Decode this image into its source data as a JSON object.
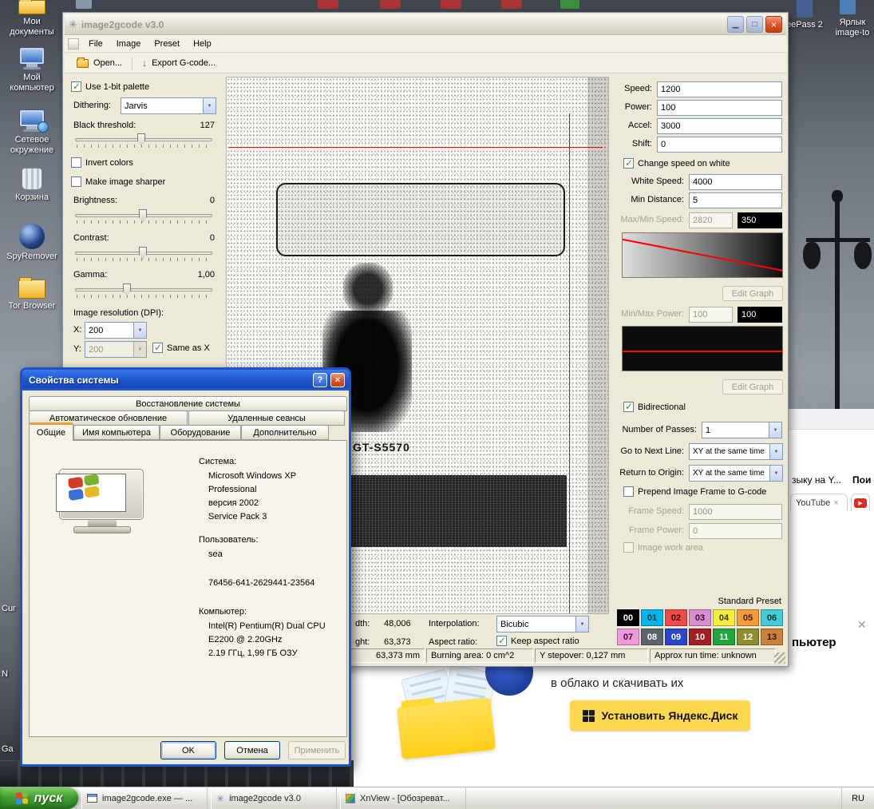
{
  "colors": {
    "guide_red": "#ff0000",
    "luna_blue": "#2058d0",
    "close_red": "#d9531f",
    "start_green": "#3fa030",
    "yandex_yellow": "#ffd84d",
    "check_green": "#21a121"
  },
  "desktop": {
    "icons": [
      {
        "label": "Мои документы"
      },
      {
        "label": "Мой компьютер"
      },
      {
        "label": "Сетевое окружение"
      },
      {
        "label": "Корзина"
      },
      {
        "label": "SpyRemover"
      },
      {
        "label": "Tor Browser"
      }
    ],
    "right_labels": [
      {
        "label": "eePass 2"
      },
      {
        "label": "Ярлык image-to"
      }
    ],
    "edge_labels": [
      {
        "label": "Cur"
      },
      {
        "label": "N"
      },
      {
        "label": "Ga"
      }
    ]
  },
  "window": {
    "title": "image2gcode v3.0",
    "menu": [
      {
        "label": "File"
      },
      {
        "label": "Image"
      },
      {
        "label": "Preset"
      },
      {
        "label": "Help"
      }
    ],
    "toolbar": {
      "open": "Open...",
      "export": "Export G-code..."
    },
    "left": {
      "use_1bit": "Use 1-bit palette",
      "dithering_label": "Dithering:",
      "dithering_value": "Jarvis",
      "black_threshold_label": "Black threshold:",
      "black_threshold_value": "127",
      "invert_colors": "Invert colors",
      "make_sharper": "Make image sharper",
      "brightness_label": "Brightness:",
      "brightness_value": "0",
      "contrast_label": "Contrast:",
      "contrast_value": "0",
      "gamma_label": "Gamma:",
      "gamma_value": "1,00",
      "resolution_label": "Image resolution (DPI):",
      "x_label": "X:",
      "x_value": "200",
      "y_label": "Y:",
      "y_value": "200",
      "same_as_x": "Same as X"
    },
    "right": {
      "speed_label": "Speed:",
      "speed": "1200",
      "power_label": "Power:",
      "power": "100",
      "accel_label": "Accel:",
      "accel": "3000",
      "shift_label": "Shift:",
      "shift": "0",
      "change_speed_on_white": "Change speed on white",
      "white_speed_label": "White Speed:",
      "white_speed": "4000",
      "min_distance_label": "Min Distance:",
      "min_distance": "5",
      "maxmin_speed_label": "Max/Min Speed:",
      "max_speed": "2820",
      "min_speed": "350",
      "edit_graph": "Edit Graph",
      "minmax_power_label": "Min/Max Power:",
      "min_power": "100",
      "max_power": "100",
      "bidirectional": "Bidirectional",
      "passes_label": "Number of Passes:",
      "passes": "1",
      "next_line_label": "Go to Next Line:",
      "next_line": "XY at the same time",
      "return_origin_label": "Return to Origin:",
      "return_origin": "XY at the same time",
      "prepend_frame": "Prepend Image Frame to G-code",
      "frame_speed_label": "Frame Speed:",
      "frame_speed": "1000",
      "frame_power_label": "Frame Power:",
      "frame_power": "0",
      "image_work_area": "Image work area",
      "standard_preset": "Standard Preset",
      "swatches": [
        {
          "label": "00",
          "bg": "#000000",
          "fg": "#ffffff"
        },
        {
          "label": "01",
          "bg": "#00b6ea",
          "fg": "#00323f"
        },
        {
          "label": "02",
          "bg": "#f04a49",
          "fg": "#3c0202"
        },
        {
          "label": "03",
          "bg": "#d98ed0",
          "fg": "#3a1236"
        },
        {
          "label": "04",
          "bg": "#f6ec3e",
          "fg": "#3c3a02"
        },
        {
          "label": "05",
          "bg": "#f59a38",
          "fg": "#3d2102"
        },
        {
          "label": "06",
          "bg": "#43cbd8",
          "fg": "#063337"
        },
        {
          "label": "07",
          "bg": "#f09add",
          "fg": "#3c1033"
        },
        {
          "label": "08",
          "bg": "#5a646e",
          "fg": "#ffffff"
        },
        {
          "label": "09",
          "bg": "#2947c8",
          "fg": "#ffffff"
        },
        {
          "label": "10",
          "bg": "#a31e22",
          "fg": "#ffffff"
        },
        {
          "label": "11",
          "bg": "#1fa53b",
          "fg": "#ffffff"
        },
        {
          "label": "12",
          "bg": "#8e8e2e",
          "fg": "#ffffff"
        },
        {
          "label": "13",
          "bg": "#c8823c",
          "fg": "#321c04"
        }
      ]
    },
    "bottom": {
      "width_label": "dth:",
      "width_value": "48,006",
      "interpolation_label": "Interpolation:",
      "interpolation_value": "Bicubic",
      "height_label": "ght:",
      "height_value": "63,373",
      "aspect_label": "Aspect ratio:",
      "keep_aspect": "Keep aspect ratio"
    },
    "status": [
      {
        "text": "63,373 mm"
      },
      {
        "text": "Burning area: 0 cm^2"
      },
      {
        "text": "Y stepover: 0,127 mm"
      },
      {
        "text": "Approx run time: unknown"
      }
    ],
    "preview": {
      "caption": "GT-S5570"
    }
  },
  "dialog": {
    "title": "Свойства системы",
    "tab_row1": [
      {
        "label": "Восстановление системы"
      }
    ],
    "tab_row2": [
      {
        "label": "Автоматическое обновление"
      },
      {
        "label": "Удаленные сеансы"
      }
    ],
    "tab_row3": [
      {
        "label": "Общие"
      },
      {
        "label": "Имя компьютера"
      },
      {
        "label": "Оборудование"
      },
      {
        "label": "Дополнительно"
      }
    ],
    "system_label": "Система:",
    "system_lines": [
      {
        "text": "Microsoft Windows XP"
      },
      {
        "text": "Professional"
      },
      {
        "text": "версия 2002"
      },
      {
        "text": "Service Pack 3"
      }
    ],
    "user_label": "Пользователь:",
    "user_name": "sea",
    "user_id": "76456-641-2629441-23564",
    "computer_label": "Компьютер:",
    "computer_lines": [
      {
        "text": "Intel(R) Pentium(R) Dual  CPU"
      },
      {
        "text": "E2200  @ 2.20GHz"
      },
      {
        "text": "2.19 ГГц, 1,99 ГБ ОЗУ"
      }
    ],
    "ok": "OK",
    "cancel": "Отмена",
    "apply": "Применить",
    "help_glyph": "?",
    "close_glyph": "×"
  },
  "browser": {
    "text_top": "зыку на Y...",
    "text_top2": "Пои",
    "youtube_tab": "YouTube",
    "tab_close": "×",
    "close_glyph": "✕",
    "text_mid": "пьютер",
    "headline": "в облако и скачивать их",
    "install_button": "Установить Яндекс.Диск",
    "yt_play": "▶"
  },
  "taskbar": {
    "start": "пуск",
    "tasks": [
      {
        "label": "image2gcode.exe — ..."
      },
      {
        "label": "image2gcode v3.0"
      },
      {
        "label": "XnView - [Обозреват..."
      }
    ],
    "tray": "RU"
  }
}
